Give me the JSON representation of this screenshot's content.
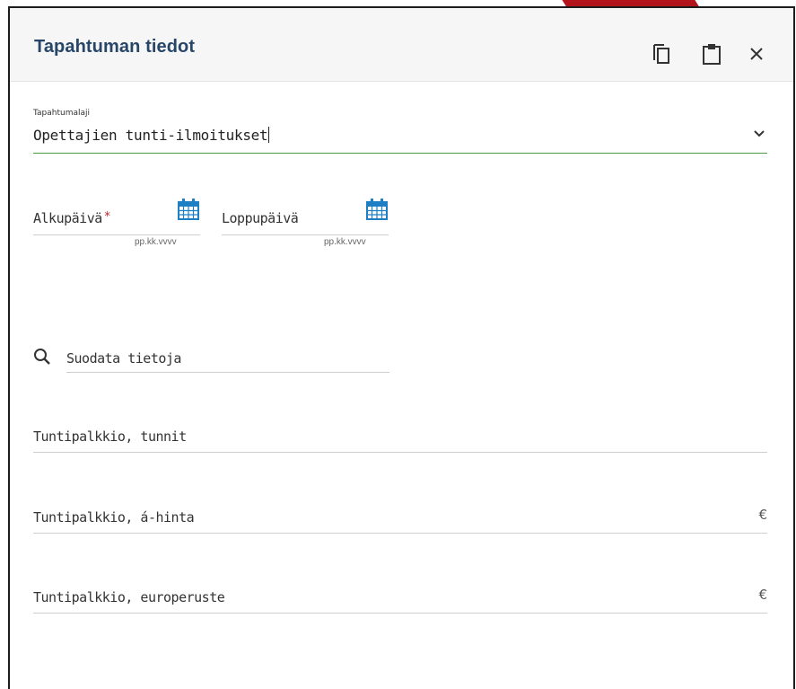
{
  "dialog": {
    "title": "Tapahtuman tiedot",
    "buttons": {
      "copy_icon": "copy-icon",
      "paste_icon": "clipboard-icon",
      "close_icon": "close-icon"
    }
  },
  "event_type": {
    "label": "Tapahtumalaji",
    "value": "Opettajien tunti-ilmoitukset"
  },
  "dates": {
    "start": {
      "label": "Alkupäivä",
      "required_mark": "*",
      "hint": "pp.kk.vvvv"
    },
    "end": {
      "label": "Loppupäivä",
      "hint": "pp.kk.vvvv"
    }
  },
  "filter": {
    "placeholder": "Suodata tietoja"
  },
  "fields": [
    {
      "label": "Tuntipalkkio, tunnit",
      "unit": ""
    },
    {
      "label": "Tuntipalkkio, á-hinta",
      "unit": "€"
    },
    {
      "label": "Tuntipalkkio, europeruste",
      "unit": "€"
    }
  ],
  "colors": {
    "title": "#274668",
    "accent_underline": "#4a9d46",
    "calendar_icon": "#1f7fc4",
    "required": "#c0262d",
    "corner_mark": "#b3131a"
  }
}
